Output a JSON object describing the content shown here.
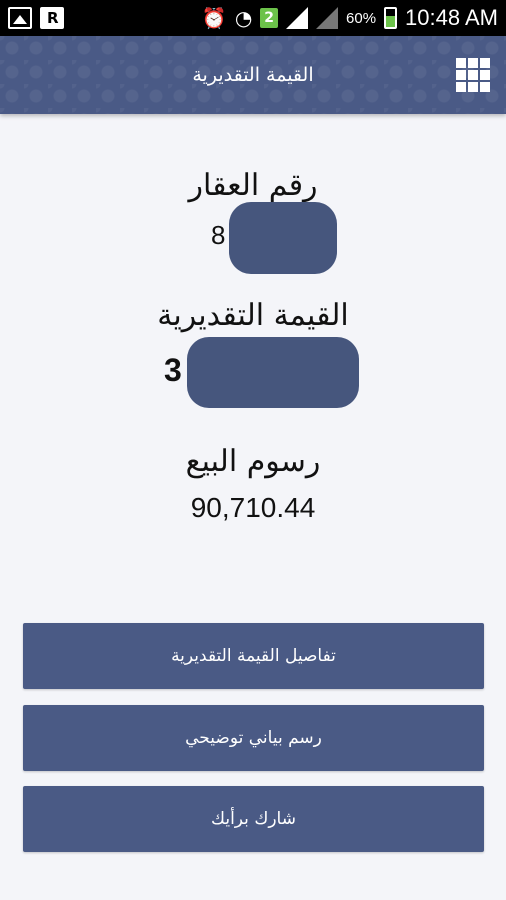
{
  "status_bar": {
    "battery_percent_label": "60%",
    "battery_level": 0.6,
    "time": "10:48 AM",
    "sim_badge": "2",
    "icons": [
      "gallery-icon",
      "app-icon",
      "alarm-icon",
      "wifi-icon",
      "signal-icon",
      "battery-icon"
    ]
  },
  "header": {
    "title": "القيمة التقديرية",
    "menu_icon": "grid-menu-icon"
  },
  "fields": {
    "property_number_label": "رقم العقار",
    "property_number_value": "8",
    "estimated_value_label": "القيمة التقديرية",
    "estimated_value_value": "3",
    "sale_fees_label": "رسوم البيع",
    "sale_fees_value": "90,710.44"
  },
  "buttons": {
    "details_label": "تفاصيل القيمة التقديرية",
    "chart_label": "رسم بياني توضيحي",
    "feedback_label": "شارك برأيك"
  },
  "colors": {
    "accent": "#4a5a85",
    "background": "#f4f5f9"
  }
}
